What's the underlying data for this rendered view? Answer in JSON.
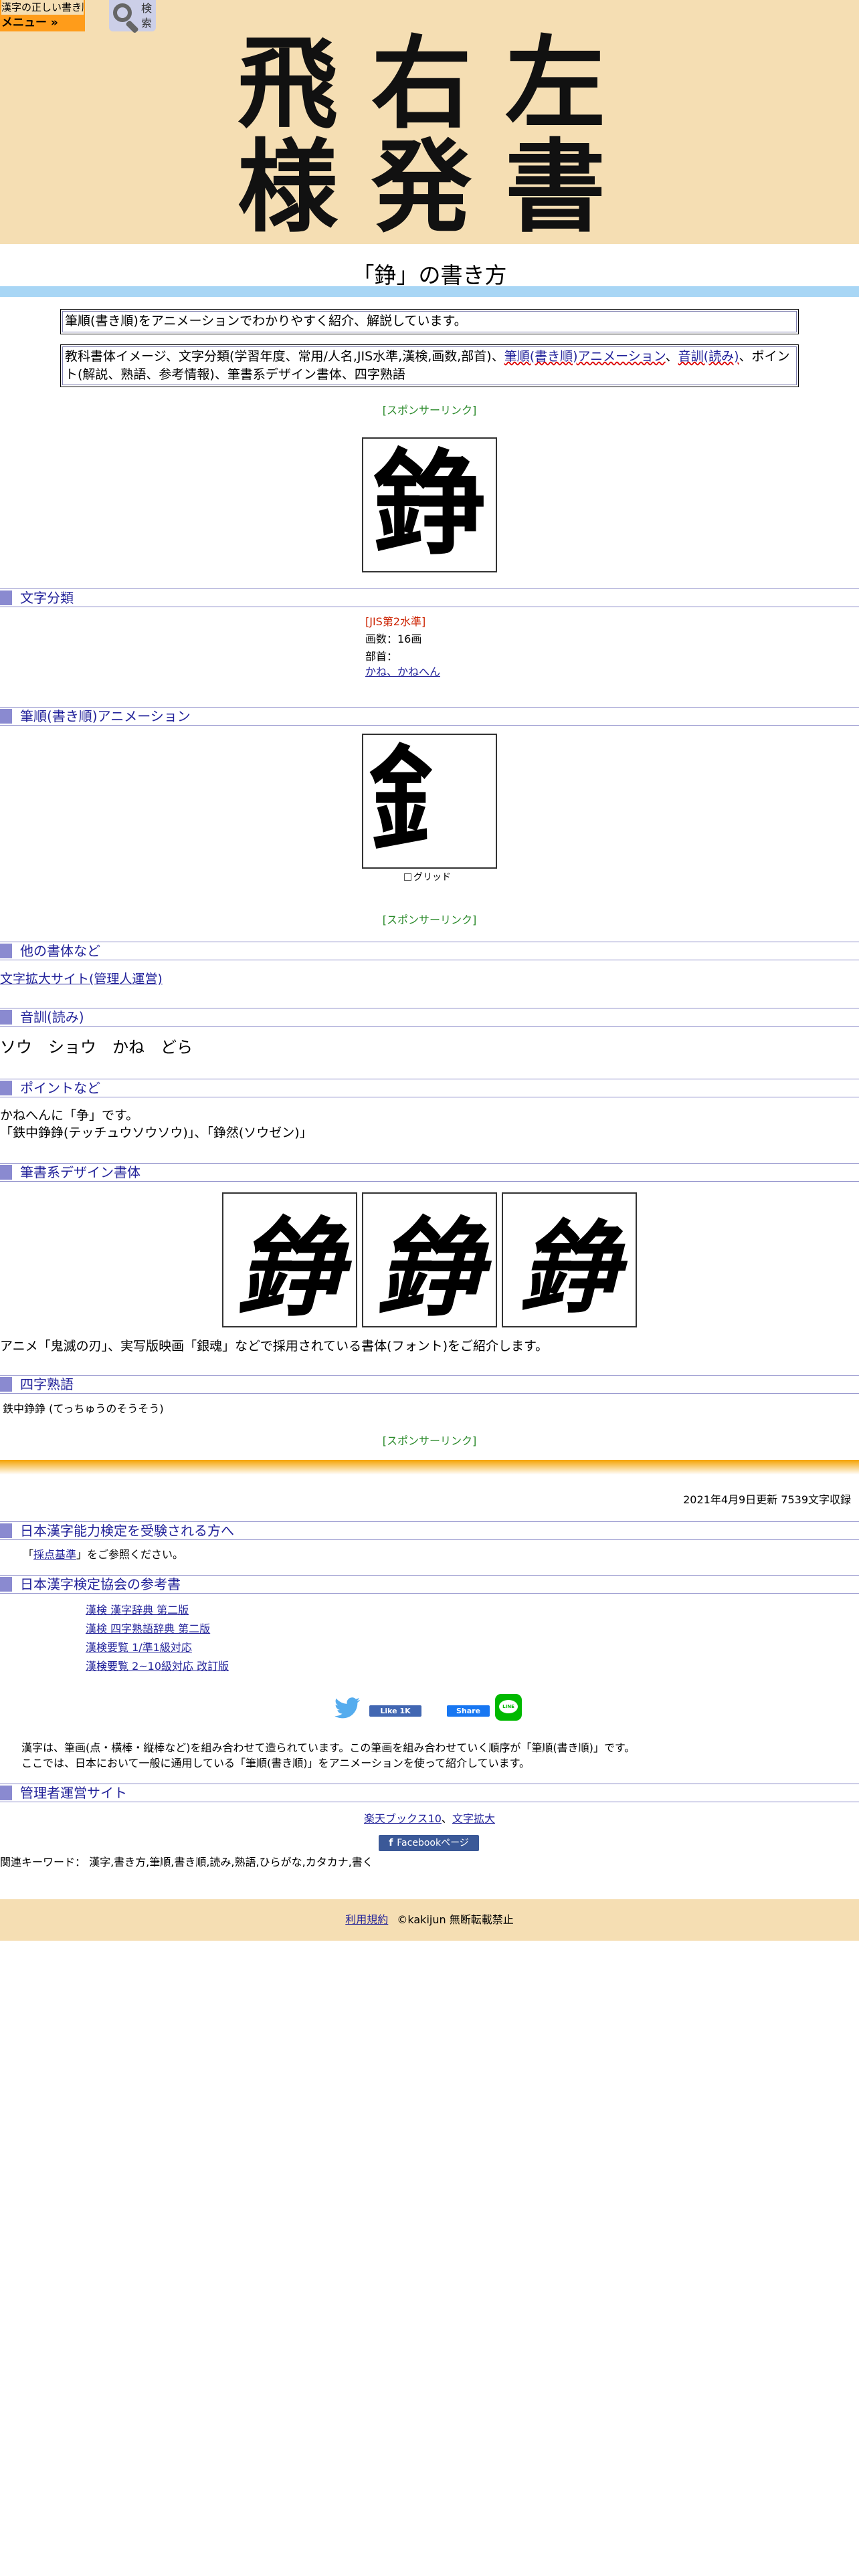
{
  "header": {
    "logo_title": "漢字の正しい書き順(筆順)",
    "menu_label": "メニュー »",
    "search_label": "検索",
    "banner_chars": [
      "飛",
      "右",
      "左",
      "様",
      "発",
      "書"
    ]
  },
  "page": {
    "title": "「錚」の書き方",
    "intro_note": "筆順(書き順)をアニメーションでわかりやすく紹介、解説しています。",
    "contents_note_1": "教科書体イメージ、文字分類(学習年度、常用/人名,JIS水準,漢検,画数,部首)、",
    "contents_note_link_1": "筆順(書き順)アニメーション",
    "contents_note_sep": "、",
    "contents_note_link_2": "音訓(読み)",
    "contents_note_2": "、ポイント(解説、熟語、参考情報)、筆書系デザイン書体、四字熟語",
    "sponsor_label": "[スポンサーリンク]",
    "kanji": "錚"
  },
  "classification": {
    "heading": "文字分類",
    "jis_level": "[JIS第2水準]",
    "strokes": "画数：16画",
    "radical_label": "部首：",
    "radical_link": "かね、かねへん"
  },
  "animation": {
    "heading": "筆順(書き順)アニメーション",
    "partial_char": "釒",
    "grid_label": "グリッド"
  },
  "other_fonts": {
    "heading": "他の書体など",
    "link": "文字拡大サイト(管理人運営)"
  },
  "reading": {
    "heading": "音訓(読み)",
    "text": "ソウ　ショウ　かね　どら"
  },
  "points": {
    "heading": "ポイントなど",
    "line1": "かねへんに「争」です。",
    "line2": "「鉄中錚錚(テッチュウソウソウ)」、「錚然(ソウゼン)」"
  },
  "design_fonts": {
    "heading": "筆書系デザイン書体",
    "caption": "アニメ「鬼滅の刃」、実写版映画「銀魂」などで採用されている書体(フォント)をご紹介します。"
  },
  "yoji": {
    "heading": "四字熟語",
    "text": "鉄中錚錚 (てっちゅうのそうそう)"
  },
  "update_info": "2021年4月9日更新 7539文字収録",
  "exam": {
    "heading": "日本漢字能力検定を受験される方へ",
    "prefix": "「",
    "link": "採点基準",
    "suffix": "」をご参照ください。"
  },
  "books": {
    "heading": "日本漢字検定協会の参考書",
    "items": [
      "漢検 漢字辞典 第二版",
      "漢検 四字熟語辞典 第二版",
      "漢検要覧 1/準1級対応",
      "漢検要覧 2~10級対応 改訂版"
    ]
  },
  "social": {
    "like_label": "Like 1K",
    "share_label": "Share",
    "line_label": "LINE"
  },
  "about": {
    "line1": "漢字は、筆画(点・横棒・縦棒など)を組み合わせて造られています。この筆画を組み合わせていく順序が「筆順(書き順)」です。",
    "line2": "ここでは、日本において一般に通用している「筆順(書き順)」をアニメーションを使って紹介しています。"
  },
  "admin": {
    "heading": "管理者運営サイト",
    "link1": "楽天ブックス10",
    "sep": "、",
    "link2": "文字拡大",
    "facebook_label": "Facebookページ"
  },
  "keywords": "関連キーワード： 漢字,書き方,筆順,書き順,読み,熟語,ひらがな,カタカナ,書く",
  "footer": {
    "terms_link": "利用規約",
    "copyright": "©kakijun 無断転載禁止"
  },
  "colors": {
    "header_bg": "#f5deb3",
    "accent_orange": "#ff9c1a",
    "section_mark": "#8a8ad0",
    "link": "#22229a",
    "sponsor_green": "#2a8a2a",
    "jis_red": "#cc2200"
  }
}
